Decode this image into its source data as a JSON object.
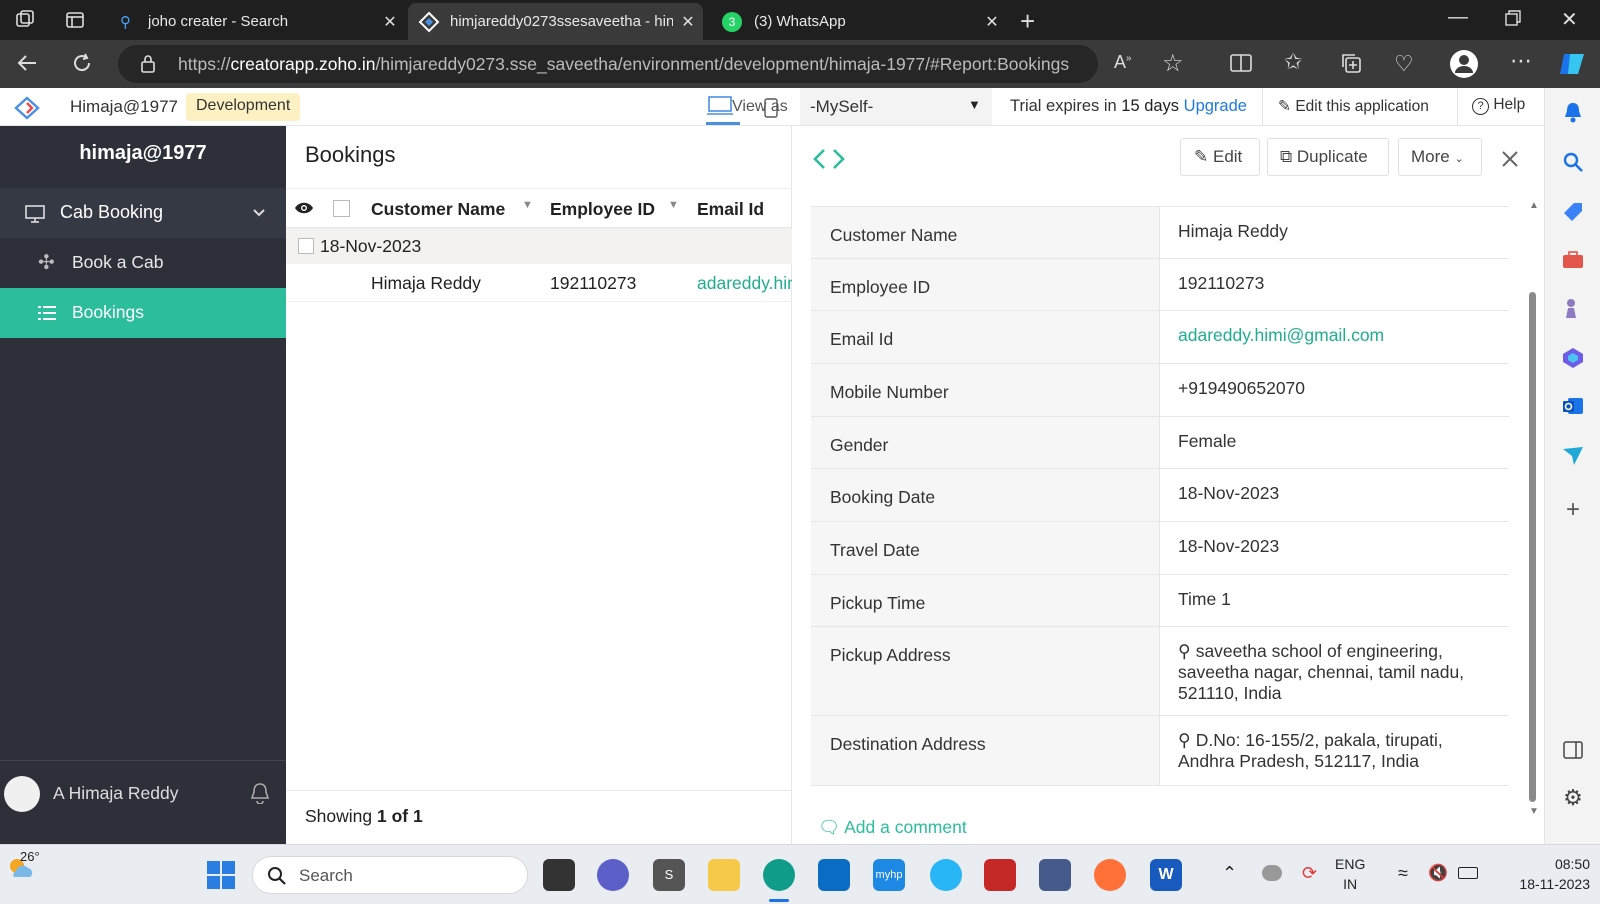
{
  "browser": {
    "tabs": [
      {
        "title": "joho creater - Search",
        "icon": "search-icon"
      },
      {
        "title": "himjareddy0273ssesaveetha - hin",
        "icon": "zoho-logo-icon"
      },
      {
        "title": "(3) WhatsApp",
        "icon": "whatsapp-icon",
        "badge": "3"
      }
    ],
    "url_prefix": "https://",
    "url_host": "creatorapp.zoho.in",
    "url_path": "/himjareddy0273.sse_saveetha/environment/development/himaja-1977/#Report:Bookings"
  },
  "app": {
    "name": "Himaja@1977",
    "env_badge": "Development",
    "view_as_label": "View as",
    "user_select": "-MySelf-",
    "trial_prefix": "Trial expires in ",
    "trial_days": "15 days",
    "upgrade": "Upgrade",
    "edit_app": "Edit this application",
    "help": "Help"
  },
  "nav": {
    "title": "himaja@1977",
    "section": "Cab Booking",
    "items": [
      {
        "label": "Book a Cab"
      },
      {
        "label": "Bookings"
      }
    ],
    "user": "A Himaja Reddy"
  },
  "report": {
    "title": "Bookings",
    "columns": [
      "Customer Name",
      "Employee ID",
      "Email Id"
    ],
    "group": "18-Nov-2023",
    "row": {
      "customer": "Himaja Reddy",
      "employee": "192110273",
      "email": "adareddy.himi@gmail.com"
    },
    "footer_prefix": "Showing ",
    "footer_bold": "1 of 1"
  },
  "detail": {
    "edit": "Edit",
    "duplicate": "Duplicate",
    "more": "More",
    "fields": [
      {
        "label": "Customer Name",
        "value": "Himaja Reddy"
      },
      {
        "label": "Employee ID",
        "value": "192110273"
      },
      {
        "label": "Email Id",
        "value": "adareddy.himi@gmail.com"
      },
      {
        "label": "Mobile Number",
        "value": "+919490652070"
      },
      {
        "label": "Gender",
        "value": "Female"
      },
      {
        "label": "Booking Date",
        "value": "18-Nov-2023"
      },
      {
        "label": "Travel Date",
        "value": "18-Nov-2023"
      },
      {
        "label": "Pickup Time",
        "value": "Time 1"
      },
      {
        "label": "Pickup Address",
        "value": "saveetha school of engineering, saveetha nagar, chennai, tamil nadu, 521110, India"
      },
      {
        "label": "Destination Address",
        "value": "D.No: 16-155/2, pakala, tirupati, Andhra Pradesh, 512117, India"
      }
    ],
    "add_comment": "Add a comment"
  },
  "taskbar": {
    "weather": "26°",
    "search": "Search",
    "lang1": "ENG",
    "lang2": "IN",
    "time": "08:50",
    "date": "18-11-2023"
  },
  "colors": {
    "accent": "#2bbd9c",
    "nav_bg": "#2d3039",
    "link": "#1fae8e",
    "env_badge_bg": "#fdf1c4"
  }
}
